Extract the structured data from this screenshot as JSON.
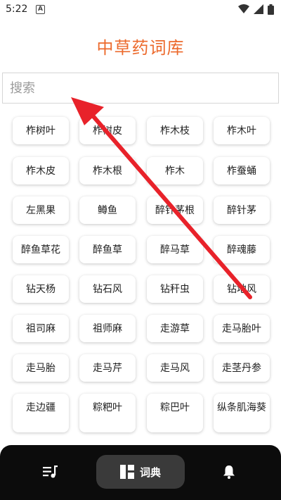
{
  "status_bar": {
    "time": "5:22",
    "notification_icon": "A"
  },
  "header": {
    "title": "中草药词库"
  },
  "search": {
    "placeholder": "搜索",
    "value": ""
  },
  "herbs": [
    "柞树叶",
    "柞树皮",
    "柞木枝",
    "柞木叶",
    "柞木皮",
    "柞木根",
    "柞木",
    "柞蚕蛹",
    "左黑果",
    "鳟鱼",
    "醉针茅根",
    "醉针茅",
    "醉鱼草花",
    "醉鱼草",
    "醉马草",
    "醉魂藤",
    "钻天杨",
    "钻石风",
    "钻秆虫",
    "钻地风",
    "祖司麻",
    "祖师麻",
    "走游草",
    "走马胎叶",
    "走马胎",
    "走马芹",
    "走马风",
    "走茎丹参",
    "走边疆",
    "粽粑叶",
    "粽巴叶",
    "纵条肌海葵"
  ],
  "bottom_nav": {
    "left_icon": "music-list-icon",
    "center_label": "词典",
    "center_icon": "dictionary-grid-icon",
    "right_icon": "bell-icon"
  },
  "colors": {
    "title": "#ec6a2c",
    "annotation_arrow": "#e8222a",
    "nav_background": "#0c0c0c",
    "nav_active": "#3a3a3a"
  }
}
